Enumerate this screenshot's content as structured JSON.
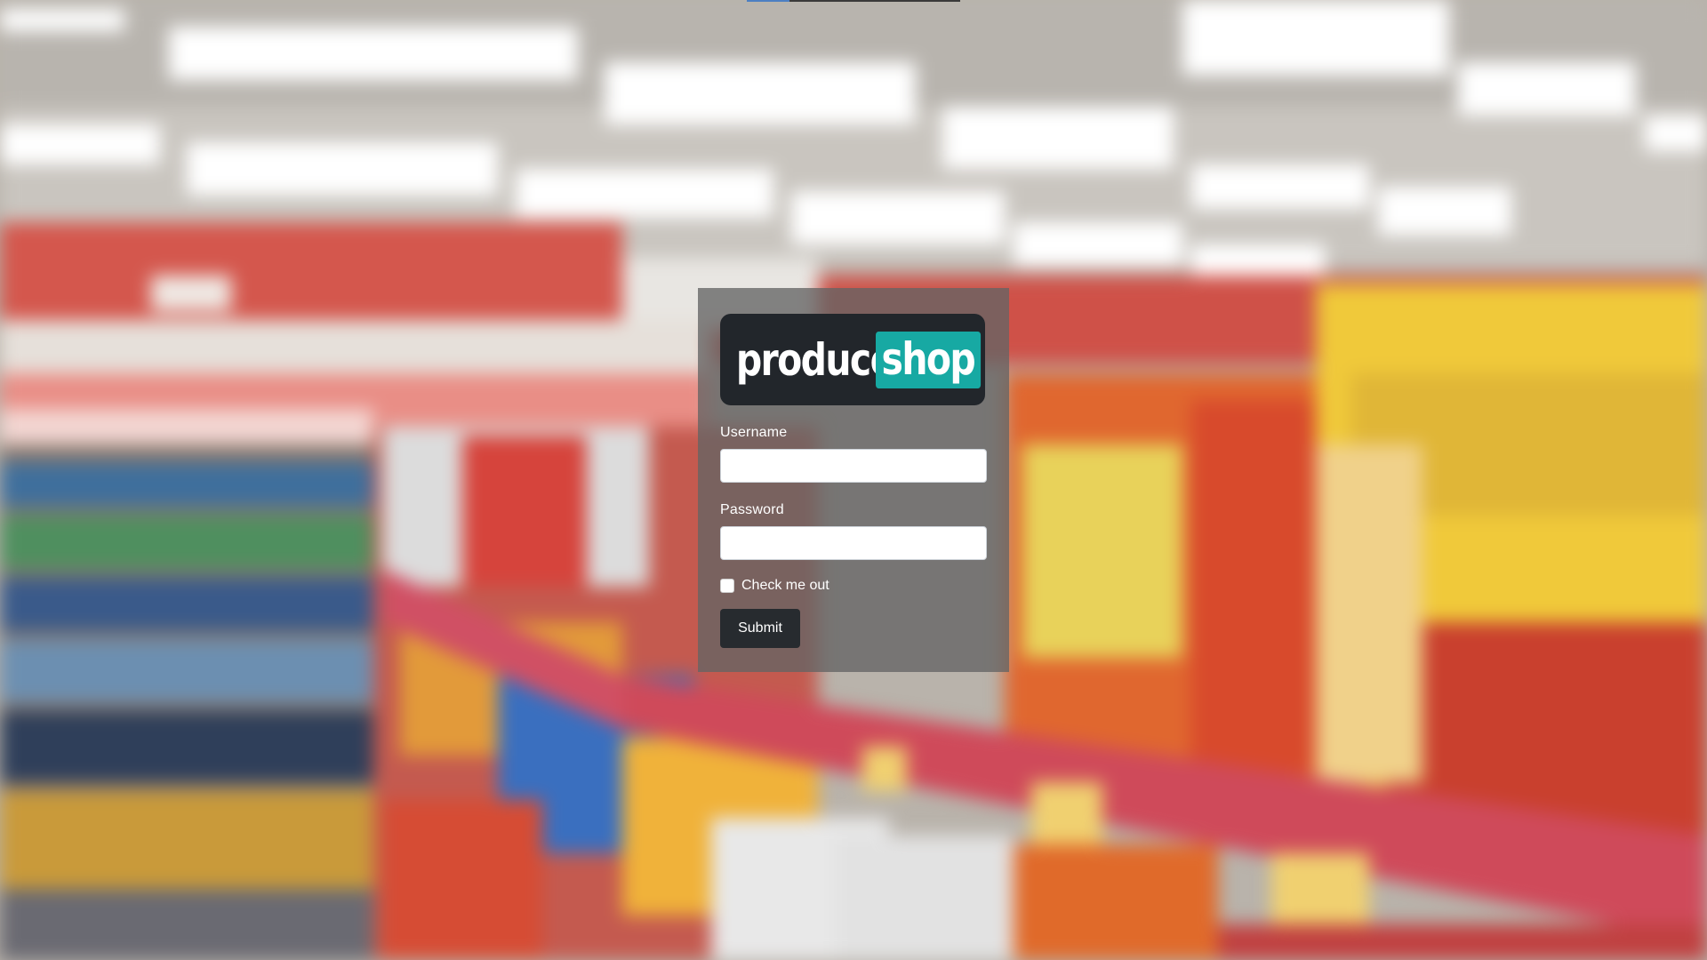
{
  "brand": {
    "part1": "produce",
    "part2": "shop",
    "accent_color": "#17a9a3",
    "logo_bg_color": "#22262b"
  },
  "form": {
    "username_label": "Username",
    "username_value": "",
    "password_label": "Password",
    "password_value": "",
    "remember_label": "Check me out",
    "remember_checked": false,
    "submit_label": "Submit"
  },
  "background": {
    "description_icon": "store-aisle-photo"
  }
}
